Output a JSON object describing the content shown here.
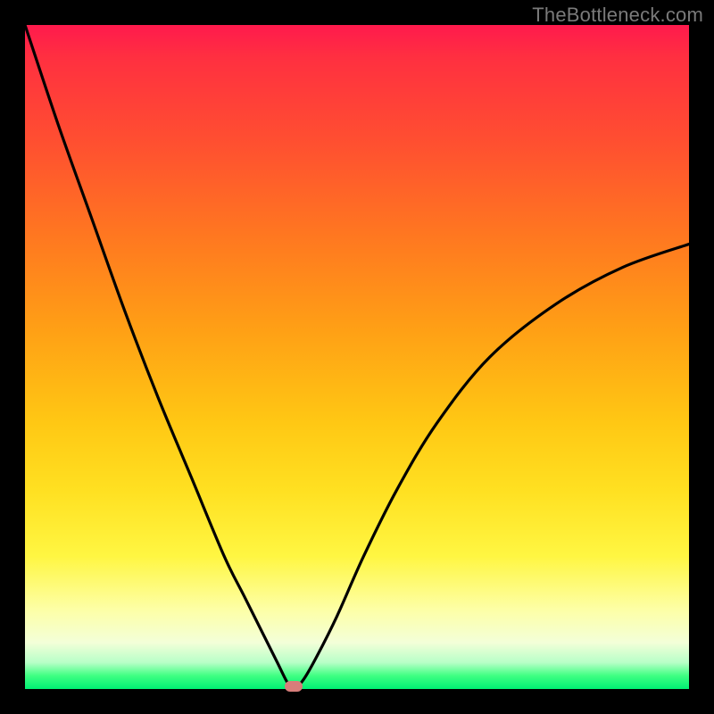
{
  "watermark": "TheBottleneck.com",
  "marker": {
    "color": "#d77d7a",
    "cx_frac": 0.405,
    "cy_frac": 0.996
  },
  "chart_data": {
    "type": "line",
    "title": "",
    "xlabel": "",
    "ylabel": "",
    "xlim": [
      0,
      1
    ],
    "ylim": [
      0,
      100
    ],
    "series": [
      {
        "name": "bottleneck-curve",
        "x": [
          0.0,
          0.05,
          0.1,
          0.15,
          0.2,
          0.25,
          0.3,
          0.33,
          0.36,
          0.38,
          0.395,
          0.405,
          0.42,
          0.44,
          0.47,
          0.51,
          0.56,
          0.62,
          0.7,
          0.8,
          0.9,
          1.0
        ],
        "values": [
          100.0,
          85.0,
          71.0,
          57.0,
          44.0,
          32.0,
          20.0,
          14.0,
          8.0,
          4.0,
          1.0,
          0.0,
          1.5,
          5.0,
          11.0,
          20.0,
          30.0,
          40.0,
          50.0,
          58.0,
          63.5,
          67.0
        ]
      }
    ],
    "annotations": [
      {
        "type": "marker",
        "x": 0.405,
        "y": 0,
        "label": "optimal-point"
      }
    ],
    "background_gradient": {
      "top": "#ff1a4d",
      "bottom": "#00ef74"
    }
  }
}
